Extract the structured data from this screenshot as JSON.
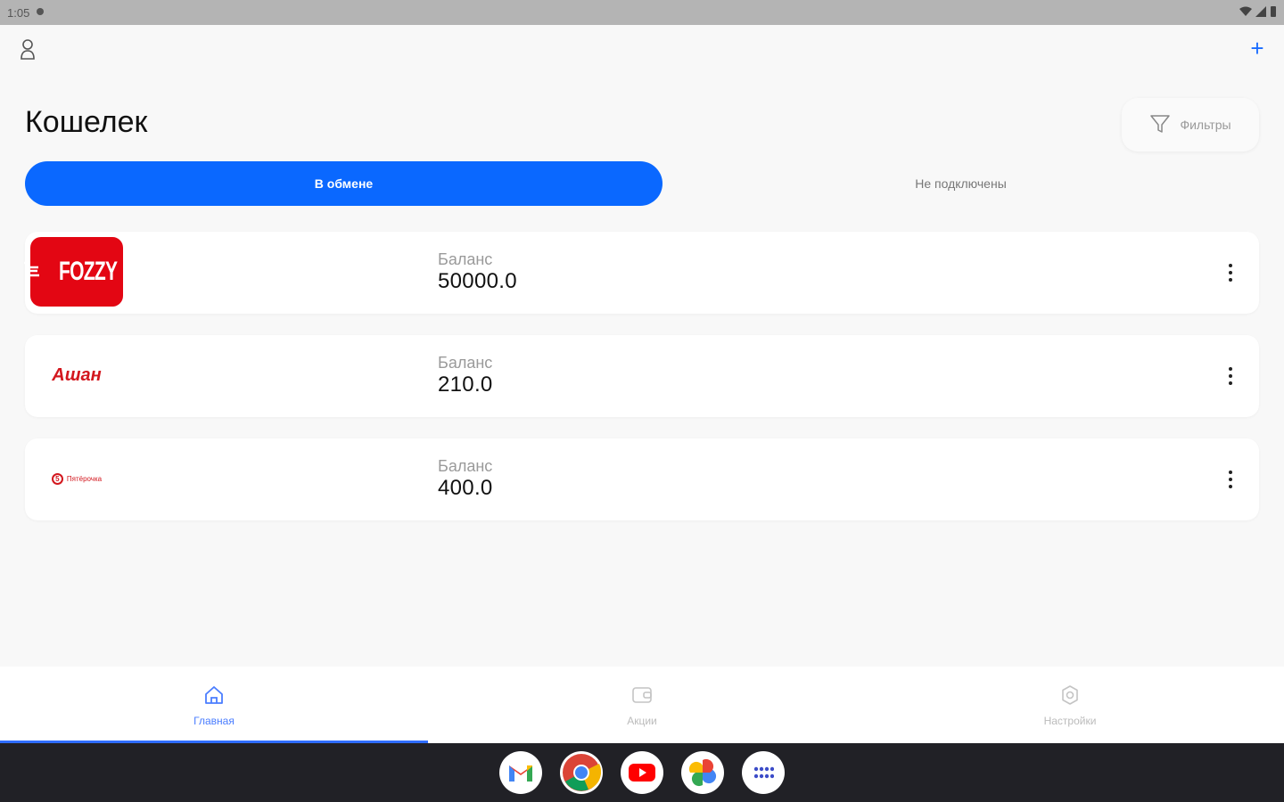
{
  "status_bar": {
    "time": "1:05"
  },
  "header": {
    "title": "Кошелек",
    "filter_label": "Фильтры"
  },
  "tabs": [
    {
      "label": "В обмене",
      "active": true
    },
    {
      "label": "Не подключены",
      "active": false
    }
  ],
  "cards": [
    {
      "store": "Fozzy",
      "logo_text": "FOZZY",
      "balance_label": "Баланс",
      "balance": "50000.0",
      "brand_color": "#e30613"
    },
    {
      "store": "Ашан",
      "logo_text": "Ашан",
      "balance_label": "Баланс",
      "balance": "210.0",
      "brand_color": "#d3171e"
    },
    {
      "store": "Пятёрочка",
      "logo_text": "Пятёрочка",
      "balance_label": "Баланс",
      "balance": "400.0",
      "brand_color": "#d3171e"
    }
  ],
  "bottom_nav": [
    {
      "label": "Главная",
      "icon": "home-icon",
      "active": true
    },
    {
      "label": "Акции",
      "icon": "wallet-icon",
      "active": false
    },
    {
      "label": "Настройки",
      "icon": "gear-icon",
      "active": false
    }
  ],
  "dock": [
    {
      "app": "Gmail",
      "icon": "gmail-icon"
    },
    {
      "app": "Chrome",
      "icon": "chrome-icon"
    },
    {
      "app": "YouTube",
      "icon": "youtube-icon"
    },
    {
      "app": "Photos",
      "icon": "photos-icon"
    },
    {
      "app": "App drawer",
      "icon": "apps-icon"
    }
  ],
  "colors": {
    "accent": "#0a68ff",
    "background": "#f8f8f8",
    "card": "#ffffff"
  }
}
